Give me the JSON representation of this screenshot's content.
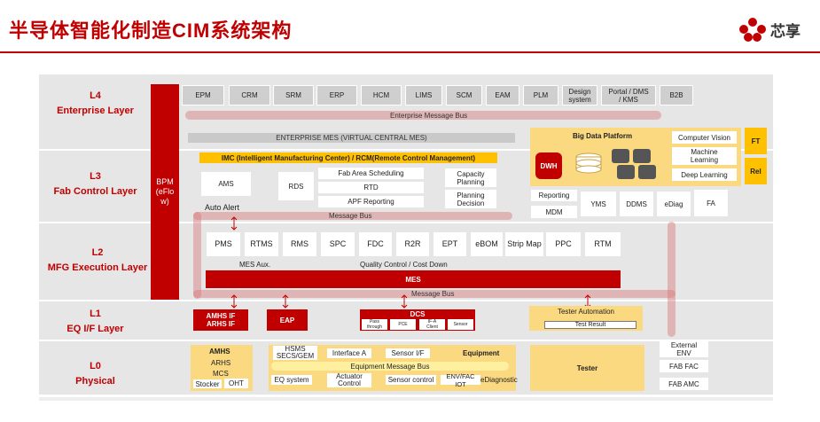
{
  "title": "半导体智能化制造CIM系统架构",
  "logo_text": "芯享",
  "layers": {
    "l4": {
      "code": "L4",
      "name": "Enterprise Layer"
    },
    "l3": {
      "code": "L3",
      "name": "Fab Control Layer"
    },
    "l2": {
      "code": "L2",
      "name": "MFG Execution Layer"
    },
    "l1": {
      "code": "L1",
      "name": "EQ I/F Layer"
    },
    "l0": {
      "code": "L0",
      "name": "Physical"
    }
  },
  "bpm": "BPM\n(eFlo\nw)",
  "l4_systems": [
    "EPM",
    "CRM",
    "SRM",
    "ERP",
    "HCM",
    "LIMS",
    "SCM",
    "EAM",
    "PLM",
    "Design\nsystem",
    "Portal / DMS\n/ KMS",
    "B2B"
  ],
  "enterprise_bus": "Enterprise Message Bus",
  "enterprise_mes": "ENTERPRISE MES (VIRTUAL CENTRAL MES)",
  "imc": "IMC (Intelligent Manufacturing Center) / RCM(Remote Control Management)",
  "l3": {
    "ams": "AMS",
    "rds": "RDS",
    "fab_area": "Fab Area Scheduling",
    "rtd": "RTD",
    "apf": "APF Reporting",
    "capacity": "Capacity\nPlanning",
    "planning": "Planning\nDecision",
    "auto_alert": "Auto Alert",
    "big_data": "Big Data Platform",
    "dwh": "DWH",
    "computer_vision": "Computer Vision",
    "machine_learning": "Machine\nLearning",
    "deep_learning": "Deep Learning",
    "ft": "FT",
    "rel": "Rel",
    "reporting": "Reporting",
    "mdm": "MDM",
    "yms": "YMS",
    "ddms": "DDMS",
    "ediag": "eDiag",
    "fa": "FA"
  },
  "message_bus": "Message Bus",
  "l2": {
    "modules": [
      "PMS",
      "RTMS",
      "RMS",
      "SPC",
      "FDC",
      "R2R",
      "EPT",
      "eBOM",
      "Strip Map",
      "PPC",
      "RTM"
    ],
    "mes_aux": "MES Aux.",
    "quality": "Quality Control / Cost Down",
    "mes": "MES"
  },
  "l1": {
    "amhs_if": "AMHS IF\nARHS IF",
    "eap": "EAP",
    "dcs": "DCS",
    "dcs_items": [
      "Pass\nthrough",
      "PCE",
      "IF-A\nClient",
      "Sensor"
    ],
    "tester_automation": "Tester Automation",
    "test_result": "Test Result"
  },
  "l0": {
    "amhs": "AMHS",
    "arhs": "ARHS",
    "mcs": "MCS",
    "stocker": "Stocker",
    "oht": "OHT",
    "hsms": "HSMS\nSECS/GEM",
    "interface_a": "Interface A",
    "sensor_if": "Sensor I/F",
    "equipment": "Equipment",
    "eq_bus": "Equipment Message Bus",
    "eq_system": "EQ system",
    "actuator": "Actuator\nControl",
    "sensor_control": "Sensor control",
    "env_fac": "ENV/FAC IOT",
    "ediagnostic": "eDiagnostic",
    "tester": "Tester",
    "external_env": "External\nENV",
    "fab_fac": "FAB FAC",
    "fab_amc": "FAB AMC"
  }
}
